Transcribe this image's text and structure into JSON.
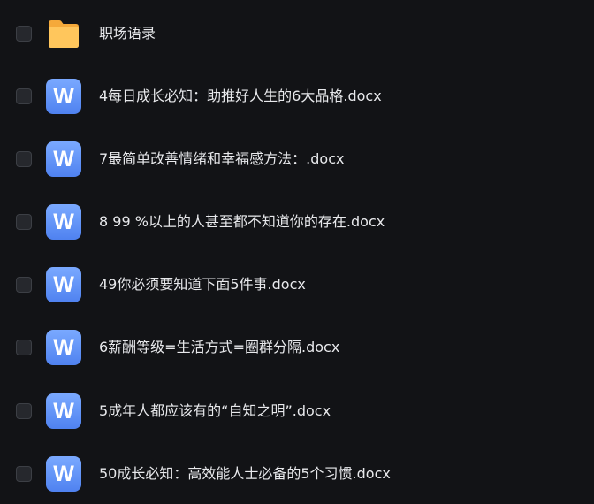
{
  "files": [
    {
      "name": "职场语录",
      "icon": "folder-icon",
      "type": "folder",
      "checked": false
    },
    {
      "name": "4每日成长必知：助推好人生的6大品格.docx",
      "icon": "word-doc-icon",
      "icon_letter": "W",
      "type": "docx",
      "checked": false
    },
    {
      "name": "7最简单改善情绪和幸福感方法：.docx",
      "icon": "word-doc-icon",
      "icon_letter": "W",
      "type": "docx",
      "checked": false
    },
    {
      "name": "8 99 %以上的人甚至都不知道你的存在.docx",
      "icon": "word-doc-icon",
      "icon_letter": "W",
      "type": "docx",
      "checked": false
    },
    {
      "name": "49你必须要知道下面5件事.docx",
      "icon": "word-doc-icon",
      "icon_letter": "W",
      "type": "docx",
      "checked": false
    },
    {
      "name": "6薪酬等级=生活方式=圈群分隔.docx",
      "icon": "word-doc-icon",
      "icon_letter": "W",
      "type": "docx",
      "checked": false
    },
    {
      "name": "5成年人都应该有的“自知之明”.docx",
      "icon": "word-doc-icon",
      "icon_letter": "W",
      "type": "docx",
      "checked": false
    },
    {
      "name": "50成长必知：高效能人士必备的5个习惯.docx",
      "icon": "word-doc-icon",
      "icon_letter": "W",
      "type": "docx",
      "checked": false
    }
  ],
  "colors": {
    "background": "#121316",
    "text": "#e8e9ec",
    "checkbox_border": "#3c3f45",
    "checkbox_fill": "#26282d",
    "word_icon": "#5b8df5",
    "folder_icon": "#fbbf4d"
  }
}
